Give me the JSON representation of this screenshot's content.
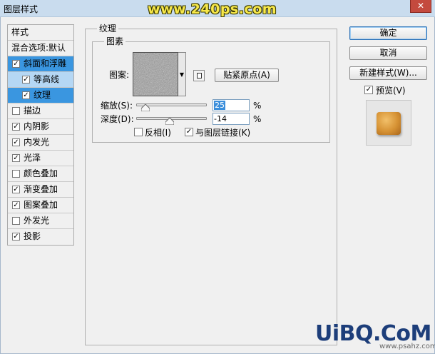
{
  "window": {
    "title": "图层样式",
    "watermark": "www.240ps.com",
    "close_glyph": "✕"
  },
  "styles_list": {
    "header": "样式",
    "blending_options": "混合选项:默认",
    "items": [
      {
        "label": "斜面和浮雕",
        "checked": true,
        "selected": true
      },
      {
        "label": "等高线",
        "checked": true,
        "sub": true
      },
      {
        "label": "纹理",
        "checked": true,
        "sub": true,
        "selected": true
      },
      {
        "label": "描边",
        "checked": false
      },
      {
        "label": "内阴影",
        "checked": true
      },
      {
        "label": "内发光",
        "checked": true
      },
      {
        "label": "光泽",
        "checked": true
      },
      {
        "label": "颜色叠加",
        "checked": false
      },
      {
        "label": "渐变叠加",
        "checked": true
      },
      {
        "label": "图案叠加",
        "checked": true
      },
      {
        "label": "外发光",
        "checked": false
      },
      {
        "label": "投影",
        "checked": true
      }
    ]
  },
  "texture_panel": {
    "group_title": "纹理",
    "subgroup_title": "图素",
    "pattern_label": "图案:",
    "snap_button": "贴紧原点(A)",
    "scale_label": "缩放(S):",
    "scale_value": "25",
    "scale_unit": "%",
    "scale_percent": 25,
    "depth_label": "深度(D):",
    "depth_value": "-14",
    "depth_unit": "%",
    "depth_percent": -14,
    "invert_label": "反相(I)",
    "invert_checked": false,
    "link_label": "与图层链接(K)",
    "link_checked": true
  },
  "right_panel": {
    "ok_button": "确定",
    "cancel_button": "取消",
    "new_style_button": "新建样式(W)...",
    "preview_label": "预览(V)",
    "preview_checked": true
  },
  "branding": {
    "logo": "UiBQ.CoM",
    "site": "www.psahz.com"
  },
  "colors": {
    "selected": "#3a96e0",
    "sub_selected": "#b5d7f4",
    "titlebar": "#c9dcee",
    "close": "#c44a3e"
  }
}
